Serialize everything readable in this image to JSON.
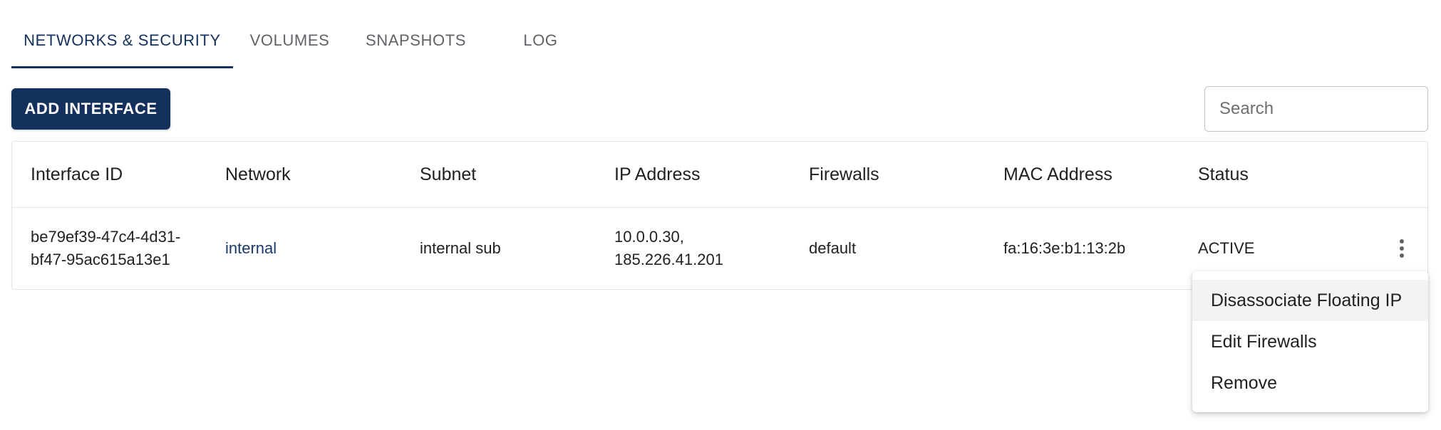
{
  "tabs": [
    {
      "label": "NETWORKS & SECURITY",
      "active": true
    },
    {
      "label": "VOLUMES",
      "active": false
    },
    {
      "label": "SNAPSHOTS",
      "active": false
    },
    {
      "label": "LOG",
      "active": false
    }
  ],
  "toolbar": {
    "add_interface_label": "ADD INTERFACE",
    "search_placeholder": "Search"
  },
  "table": {
    "headers": [
      "Interface ID",
      "Network",
      "Subnet",
      "IP Address",
      "Firewalls",
      "MAC Address",
      "Status"
    ],
    "rows": [
      {
        "interface_id": "be79ef39-47c4-4d31-bf47-95ac615a13e1",
        "network": "internal",
        "subnet": "internal sub",
        "ip_address": "10.0.0.30, 185.226.41.201",
        "firewalls": "default",
        "mac_address": "fa:16:3e:b1:13:2b",
        "status": "ACTIVE"
      }
    ]
  },
  "row_menu": {
    "items": [
      "Disassociate Floating IP",
      "Edit Firewalls",
      "Remove"
    ]
  },
  "colors": {
    "primary": "#13315c",
    "link": "#1a3a6b"
  },
  "icons": {
    "row_actions": "more-vert-icon"
  }
}
